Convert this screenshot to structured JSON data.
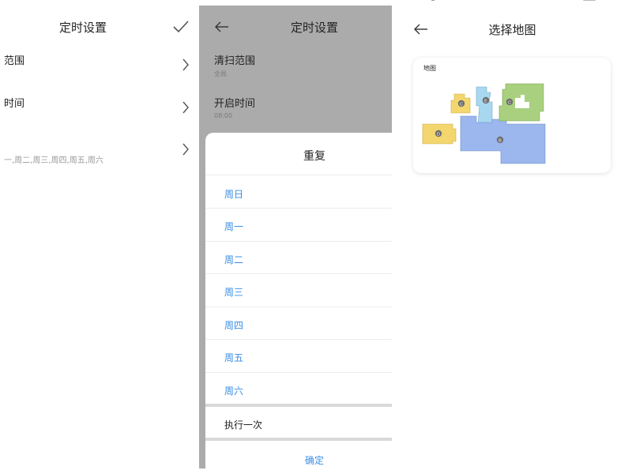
{
  "panel1": {
    "title": "定时设置",
    "rows": [
      {
        "label": "范围"
      },
      {
        "label": "时间"
      },
      {
        "sub": "一,周二,周三,周四,周五,周六"
      }
    ]
  },
  "panel2": {
    "title": "定时设置",
    "clean_range": {
      "label": "清扫范围",
      "value": "全局"
    },
    "start_time": {
      "label": "开启时间",
      "value": "08:00"
    },
    "sheet": {
      "title": "重复",
      "days": [
        "周日",
        "周一",
        "周二",
        "周三",
        "周四",
        "周五",
        "周六"
      ],
      "once": "执行一次",
      "confirm": "确定"
    }
  },
  "panel3": {
    "title": "选择地图",
    "map_card": {
      "label": "地图",
      "room_markers": [
        "B",
        "C",
        "D",
        "E"
      ]
    }
  },
  "colors": {
    "accent": "#3a8ee6",
    "overlay": "#ababab",
    "room_blue": "#9bb7ee",
    "room_green": "#a9d07f",
    "room_yellow": "#f3d66d",
    "room_cyan": "#a8d8f0",
    "marker": "#6d6d6d"
  }
}
